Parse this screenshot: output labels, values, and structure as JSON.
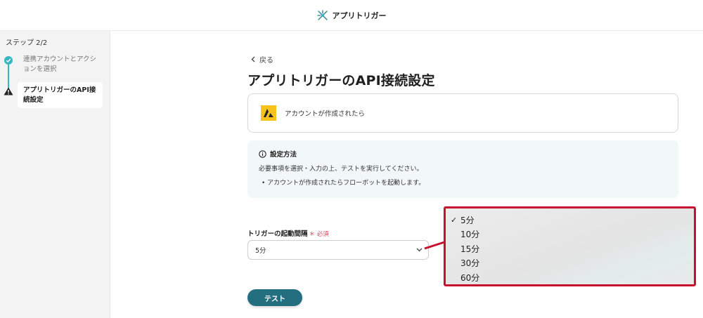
{
  "header": {
    "title": "アプリトリガー",
    "icon": "app-trigger-icon"
  },
  "sidebar": {
    "step_label": "ステップ 2/2",
    "steps": [
      {
        "label": "連携アカウントとアクションを選択",
        "status": "done"
      },
      {
        "label": "アプリトリガーのAPI接続設定",
        "status": "warning"
      }
    ]
  },
  "main": {
    "back_label": "戻る",
    "title": "アプリトリガーのAPI接続設定",
    "app_card": {
      "text": "アカウントが作成されたら"
    },
    "info": {
      "heading": "設定方法",
      "line1": "必要事項を選択・入力の上、テストを実行してください。",
      "bullet": "• アカウントが作成されたらフローボットを起動します。"
    },
    "field": {
      "label": "トリガーの起動間隔",
      "required": "＊ 必須",
      "value": "5分"
    },
    "test_label": "テスト"
  },
  "dropdown": {
    "options": [
      {
        "label": "5分",
        "selected": "✓"
      },
      {
        "label": "10分",
        "selected": ""
      },
      {
        "label": "15分",
        "selected": ""
      },
      {
        "label": "30分",
        "selected": ""
      },
      {
        "label": "60分",
        "selected": ""
      }
    ]
  },
  "colors": {
    "accent": "#37b6c4",
    "button": "#236f80",
    "highlight": "#c8102e",
    "required": "#e0445b"
  }
}
